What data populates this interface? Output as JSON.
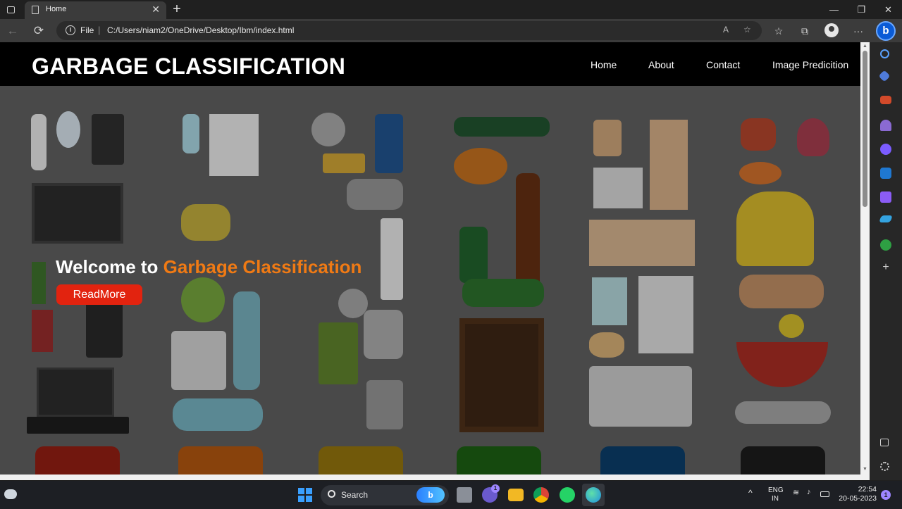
{
  "browser": {
    "tab_title": "Home",
    "tab_close": "✕",
    "new_tab": "+",
    "minimize": "—",
    "maximize": "❐",
    "close": "✕",
    "back": "←",
    "refresh": "⟳",
    "info_icon": "i",
    "scheme": "File",
    "separator": "|",
    "url": "C:/Users/niam2/OneDrive/Desktop/Ibm/index.html",
    "read_aloud": "A",
    "favorites_add": "☆",
    "favorites": "☆",
    "collections": "⧉",
    "menu": "···",
    "bing": "b"
  },
  "site": {
    "title": "GARBAGE CLASSIFICATION",
    "nav": [
      "Home",
      "About",
      "Contact",
      "Image Predicition"
    ],
    "hero": {
      "welcome_prefix": "Welcome to",
      "welcome_accent": "Garbage Classification",
      "button_label": "ReadMore",
      "accent_color": "#f07a14",
      "button_color": "#e2230f"
    }
  },
  "scroll": {
    "up": "▲",
    "down": "▼"
  },
  "taskbar": {
    "search_label": "Search",
    "bing_pill": "b",
    "teams_badge": "1",
    "tray_chevron": "^",
    "language_line1": "ENG",
    "language_line2": "IN",
    "time": "22:54",
    "date": "20-05-2023",
    "notification_count": "1"
  },
  "icons": {
    "tab": "document-icon",
    "sidebar": [
      "search-icon",
      "tag-icon",
      "briefcase-icon",
      "chess-icon",
      "copilot-icon",
      "outlook-icon",
      "drop-icon",
      "send-icon",
      "tree-icon",
      "add-icon",
      "split-screen-icon",
      "settings-icon"
    ]
  }
}
